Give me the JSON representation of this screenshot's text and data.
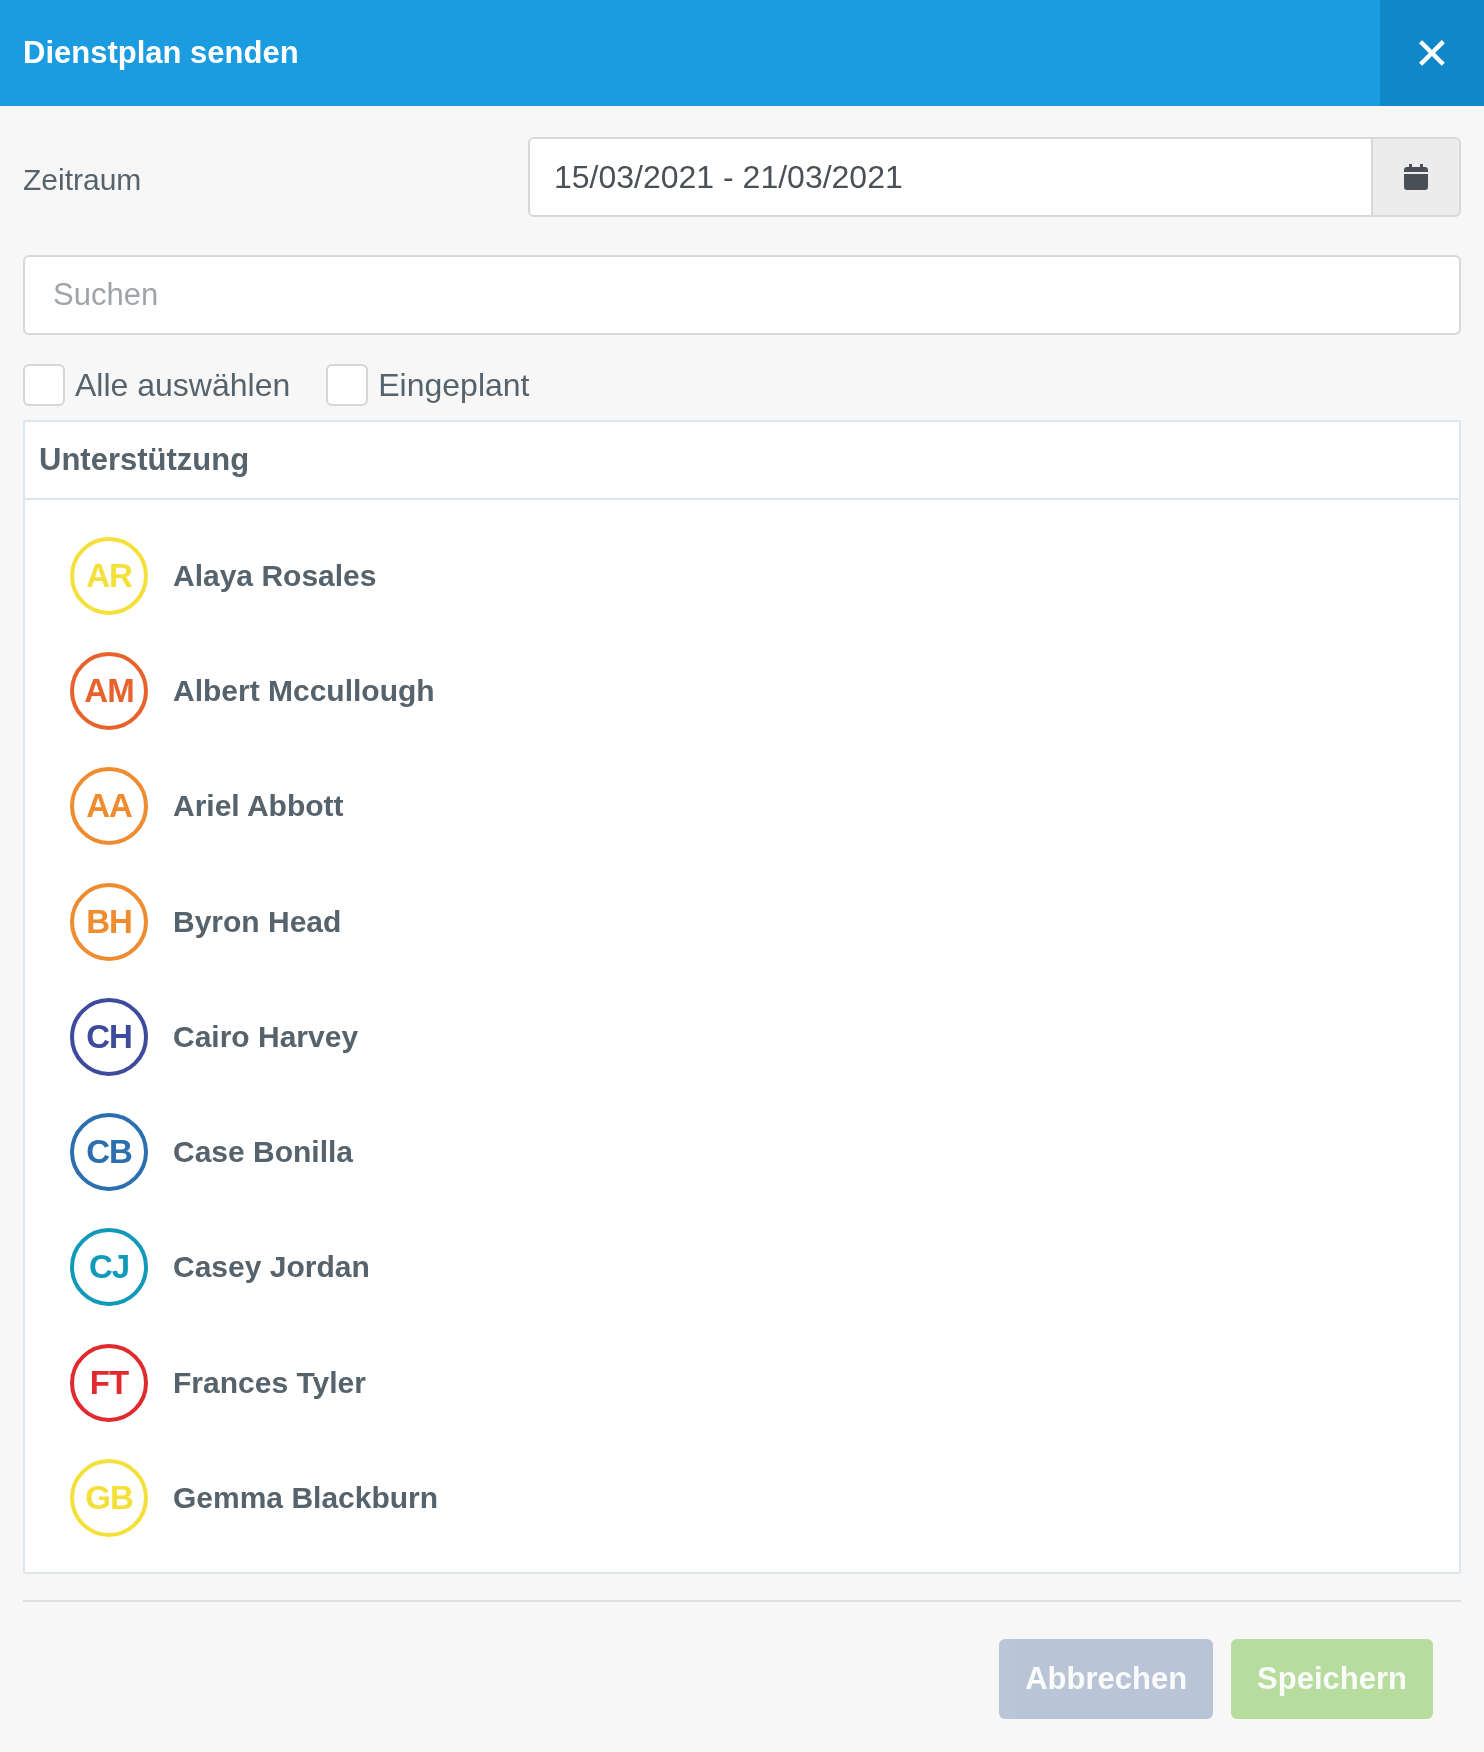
{
  "window": {
    "title": "Dienstplan senden",
    "close": "✕"
  },
  "period": {
    "label": "Zeitraum",
    "value": "15/03/2021 - 21/03/2021"
  },
  "search": {
    "placeholder": "Suchen"
  },
  "filters": [
    {
      "label": "Alle auswählen",
      "checked": false
    },
    {
      "label": "Eingeplant",
      "checked": false
    }
  ],
  "group": {
    "title": "Unterstützung",
    "people": [
      {
        "initials": "AR",
        "name": "Alaya Rosales",
        "color": "#f4e03a"
      },
      {
        "initials": "AM",
        "name": "Albert Mccullough",
        "color": "#e8622c"
      },
      {
        "initials": "AA",
        "name": "Ariel Abbott",
        "color": "#f08c30"
      },
      {
        "initials": "BH",
        "name": "Byron Head",
        "color": "#f08c30"
      },
      {
        "initials": "CH",
        "name": "Cairo Harvey",
        "color": "#3e4a9b"
      },
      {
        "initials": "CB",
        "name": "Case Bonilla",
        "color": "#2b6fb0"
      },
      {
        "initials": "CJ",
        "name": "Casey Jordan",
        "color": "#1099b8"
      },
      {
        "initials": "FT",
        "name": "Frances Tyler",
        "color": "#e02a2e"
      },
      {
        "initials": "GB",
        "name": "Gemma Blackburn",
        "color": "#f4e03a"
      }
    ]
  },
  "buttons": [
    {
      "label": "Abbrechen",
      "kind": "cancel",
      "disabled": true
    },
    {
      "label": "Speichern",
      "kind": "save",
      "disabled": true
    }
  ]
}
